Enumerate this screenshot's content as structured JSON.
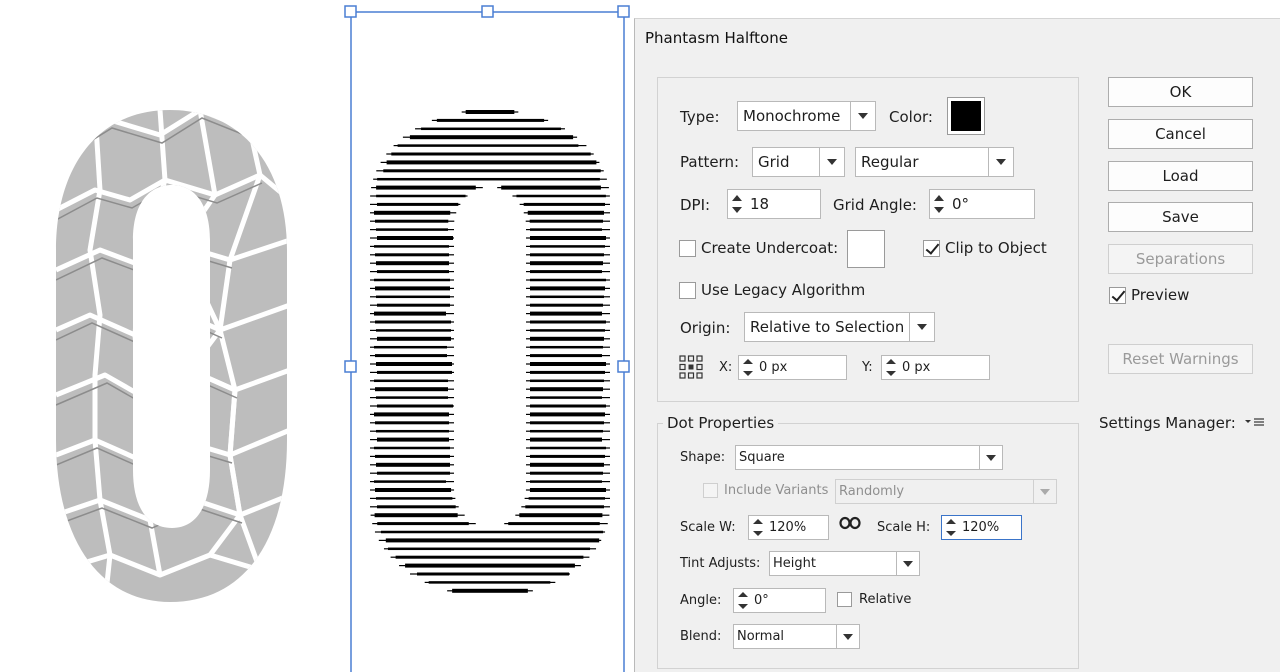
{
  "dialog": {
    "title": "Phantasm Halftone",
    "type_label": "Type:",
    "type_value": "Monochrome",
    "color_label": "Color:",
    "color_swatch": "#000000",
    "pattern_label": "Pattern:",
    "pattern_value": "Grid",
    "pattern_style_value": "Regular",
    "dpi_label": "DPI:",
    "dpi_value": "18",
    "grid_angle_label": "Grid Angle:",
    "grid_angle_value": "0°",
    "create_undercoat_label": "Create Undercoat:",
    "create_undercoat_checked": false,
    "undercoat_swatch": "#ffffff",
    "clip_to_object_label": "Clip to Object",
    "clip_to_object_checked": true,
    "legacy_label": "Use Legacy Algorithm",
    "legacy_checked": false,
    "origin_label": "Origin:",
    "origin_value": "Relative to Selection",
    "x_label": "X:",
    "x_value": "0 px",
    "y_label": "Y:",
    "y_value": "0 px",
    "dot_properties": {
      "legend": "Dot Properties",
      "shape_label": "Shape:",
      "shape_value": "Square",
      "include_variants_label": "Include Variants",
      "include_variants_checked": false,
      "variants_value": "Randomly",
      "scale_w_label": "Scale W:",
      "scale_w_value": "120%",
      "scale_h_label": "Scale H:",
      "scale_h_value": "120%",
      "tint_adjusts_label": "Tint Adjusts:",
      "tint_adjusts_value": "Height",
      "angle_label": "Angle:",
      "angle_value": "0°",
      "relative_label": "Relative",
      "relative_checked": false,
      "blend_label": "Blend:",
      "blend_value": "Normal"
    },
    "buttons": {
      "ok": "OK",
      "cancel": "Cancel",
      "load": "Load",
      "save": "Save",
      "separations": "Separations",
      "reset_warnings": "Reset Warnings"
    },
    "preview_label": "Preview",
    "preview_checked": true,
    "settings_manager_label": "Settings Manager:"
  },
  "colors": {
    "selection_blue": "#4a7fd4",
    "glass_fill": "#bcbcbc",
    "halftone_ink": "#000000"
  }
}
